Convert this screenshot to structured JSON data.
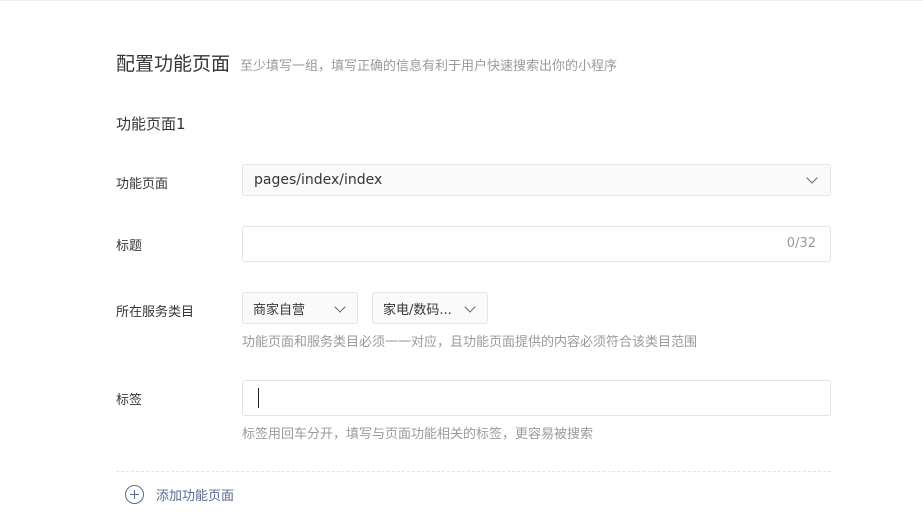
{
  "header": {
    "title": "配置功能页面",
    "description": "至少填写一组，填写正确的信息有利于用户快速搜索出你的小程序"
  },
  "group": {
    "title": "功能页面1"
  },
  "fields": {
    "page": {
      "label": "功能页面",
      "value": "pages/index/index"
    },
    "title": {
      "label": "标题",
      "value": "",
      "counter": "0/32"
    },
    "category": {
      "label": "所在服务类目",
      "primary": "商家自营",
      "secondary": "家电/数码...",
      "hint": "功能页面和服务类目必须一一对应，且功能页面提供的内容必须符合该类目范围"
    },
    "tags": {
      "label": "标签",
      "value": "",
      "hint": "标签用回车分开，填写与页面功能相关的标签，更容易被搜索"
    }
  },
  "actions": {
    "add_page_label": "添加功能页面"
  },
  "icons": {
    "add": "plus-circle-icon",
    "dropdown": "chevron-down-icon"
  },
  "colors": {
    "link": "#576b95",
    "hint_text": "#9a9a9a",
    "border": "#e4e4e4"
  }
}
